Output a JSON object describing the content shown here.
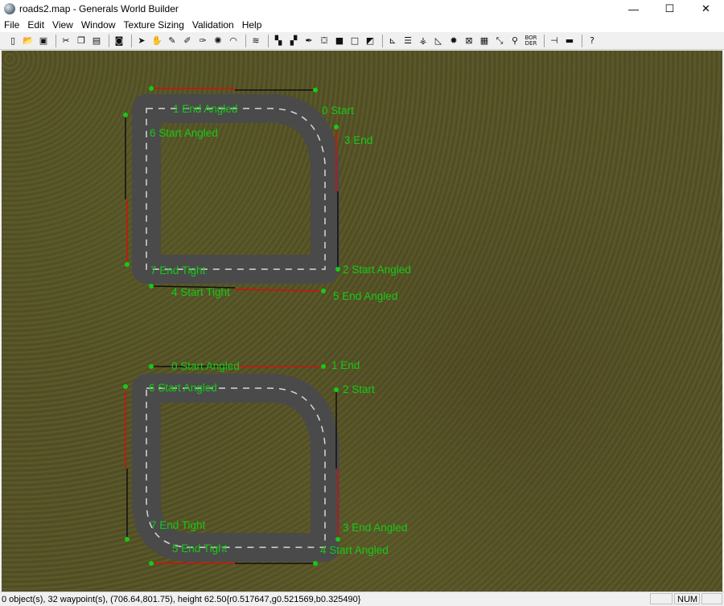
{
  "window": {
    "title": "roads2.map - Generals World Builder",
    "minimize": "—",
    "maximize": "☐",
    "close": "✕"
  },
  "menu": [
    "File",
    "Edit",
    "View",
    "Window",
    "Texture Sizing",
    "Validation",
    "Help"
  ],
  "toolbar": {
    "icons": [
      "new-icon",
      "open-icon",
      "save-icon",
      "sep",
      "cut-icon",
      "copy-icon",
      "paste-icon",
      "sep",
      "map-icon",
      "sep",
      "pointer-icon",
      "hand-icon",
      "brush-icon",
      "brush2-icon",
      "brush3-icon",
      "star-icon",
      "dome-icon",
      "sep",
      "waves-icon",
      "sep",
      "checker-icon",
      "checker2-icon",
      "eyedropper-icon",
      "fill-icon",
      "square-icon",
      "outline-square-icon",
      "ramp-icon",
      "sep",
      "axis-icon",
      "road-icon",
      "tree-icon",
      "triangle-icon",
      "blob-icon",
      "grid-icon",
      "fence-icon",
      "waypoint-icon",
      "link-icon",
      "border-icon",
      "sep",
      "scale-icon",
      "bridge-icon",
      "sep",
      "help-icon"
    ],
    "border_label_top": "BOR",
    "border_label_bottom": "DER"
  },
  "waypoints": {
    "top": {
      "l1": "1 End Angled",
      "l0": "0 Start",
      "l6": "6 Start Angled",
      "l3": "3 End",
      "l7": "7 End Tight",
      "l2": "2 Start Angled",
      "l4": "4 Start Tight",
      "l5": "5 End Angled"
    },
    "bottom": {
      "l0": "0 Start Angled",
      "l1": "1 End",
      "l6": "6 Start Angled",
      "l2": "2 Start",
      "l7": "7 End Tight",
      "l3": "3 End Angled",
      "l5": "5 End Tight",
      "l4": "4 Start Angled"
    }
  },
  "status": {
    "text": "0 object(s), 32 waypoint(s), (706.64,801.75), height 62.50{r0.517647,g0.521569,b0.325490}",
    "num": "NUM"
  },
  "colors": {
    "label": "#18c818",
    "red_arrow": "#d01010",
    "black_arrow": "#101010",
    "road": "#4a4a4a",
    "grass": "#585628"
  }
}
